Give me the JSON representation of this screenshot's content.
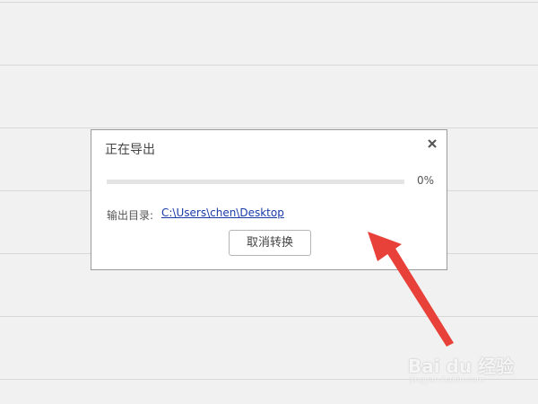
{
  "dialog": {
    "title": "正在导出",
    "close_icon": "close-icon",
    "progress": {
      "percent_value": 0,
      "percent_label": "0%"
    },
    "output_label": "输出目录:",
    "output_path": "C:\\Users\\chen\\Desktop",
    "cancel_label": "取消转换"
  },
  "watermark": {
    "main": "Bai du 经验",
    "sub": "jingyan.baidu.com"
  },
  "colors": {
    "annotation_arrow": "#e8413a",
    "link": "#1a3aa8",
    "background": "#f1f1f1"
  }
}
